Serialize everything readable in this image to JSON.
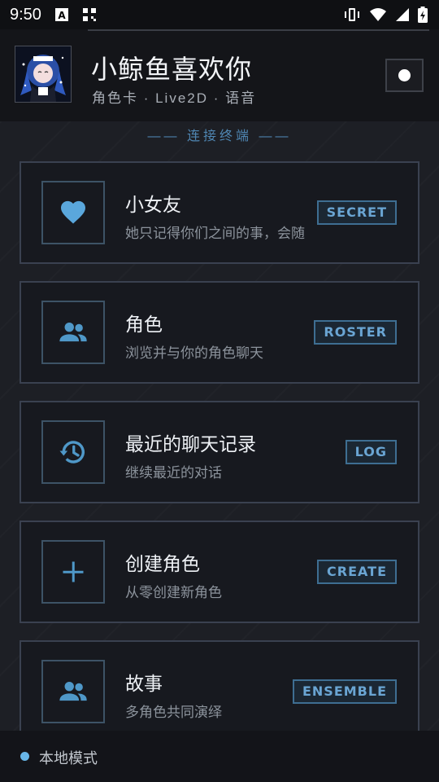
{
  "status_bar": {
    "time": "9:50",
    "icons": [
      "font-icon",
      "qr-icon",
      "vibrate-icon",
      "wifi-icon",
      "signal-icon",
      "battery-charging-icon"
    ]
  },
  "header": {
    "title": "小鲸鱼喜欢你",
    "subtitle": "角色卡 · Live2D · 语音",
    "menu_icon": "dot-menu-icon"
  },
  "section_label": "—— 连接终端 ——",
  "cards": [
    {
      "title": "小女友",
      "desc": "她只记得你们之间的事，会随",
      "tag": "SECRET",
      "icon": "heart-icon"
    },
    {
      "title": "角色",
      "desc": "浏览并与你的角色聊天",
      "tag": "ROSTER",
      "icon": "group-icon"
    },
    {
      "title": "最近的聊天记录",
      "desc": "继续最近的对话",
      "tag": "LOG",
      "icon": "history-icon"
    },
    {
      "title": "创建角色",
      "desc": "从零创建新角色",
      "tag": "CREATE",
      "icon": "plus-icon"
    },
    {
      "title": "故事",
      "desc": "多角色共同演绎",
      "tag": "ENSEMBLE",
      "icon": "group-icon"
    }
  ],
  "bottom_bar": {
    "label": "本地模式"
  },
  "colors": {
    "accent": "#6aa5d3",
    "icon": "#4f98c8",
    "background": "#17181d",
    "indicator": "#68b6e8"
  }
}
